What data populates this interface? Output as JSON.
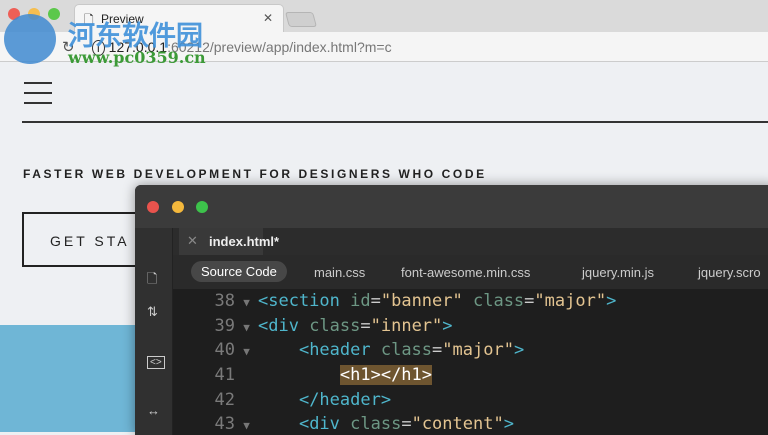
{
  "browser": {
    "tab_title": "Preview",
    "url_host": "127.0.0.1",
    "url_rest": ":60212/preview/app/index.html?m=c"
  },
  "page": {
    "tagline": "FASTER WEB DEVELOPMENT FOR DESIGNERS WHO CODE",
    "cta": "GET STA"
  },
  "editor": {
    "tab": "index.html*",
    "files": [
      "Source Code",
      "main.css",
      "font-awesome.min.css",
      "jquery.min.js",
      "jquery.scro"
    ],
    "lines": [
      {
        "n": "38",
        "fold": "▼",
        "indent": "",
        "parts": [
          [
            "t",
            "<section "
          ],
          [
            "a",
            "id"
          ],
          [
            "e",
            "="
          ],
          [
            "s",
            "\"banner\""
          ],
          [
            "a",
            " class"
          ],
          [
            "e",
            "="
          ],
          [
            "s",
            "\"major\""
          ],
          [
            "t",
            ">"
          ]
        ]
      },
      {
        "n": "39",
        "fold": "▼",
        "indent": "",
        "parts": [
          [
            "t",
            "<div "
          ],
          [
            "a",
            "class"
          ],
          [
            "e",
            "="
          ],
          [
            "s",
            "\"inner\""
          ],
          [
            "t",
            ">"
          ]
        ]
      },
      {
        "n": "40",
        "fold": "▼",
        "indent": "    ",
        "parts": [
          [
            "t",
            "<header "
          ],
          [
            "a",
            "class"
          ],
          [
            "e",
            "="
          ],
          [
            "s",
            "\"major\""
          ],
          [
            "t",
            ">"
          ]
        ]
      },
      {
        "n": "41",
        "fold": "",
        "indent": "        ",
        "parts": [
          [
            "hl",
            "<h1></h1>"
          ]
        ]
      },
      {
        "n": "42",
        "fold": "",
        "indent": "    ",
        "parts": [
          [
            "t",
            "</header>"
          ]
        ]
      },
      {
        "n": "43",
        "fold": "▼",
        "indent": "    ",
        "parts": [
          [
            "t",
            "<div "
          ],
          [
            "a",
            "class"
          ],
          [
            "e",
            "="
          ],
          [
            "s",
            "\"content\""
          ],
          [
            "t",
            ">"
          ]
        ]
      }
    ]
  },
  "watermark": {
    "cn": "河东软件园",
    "en": "www.pc0359.cn"
  }
}
